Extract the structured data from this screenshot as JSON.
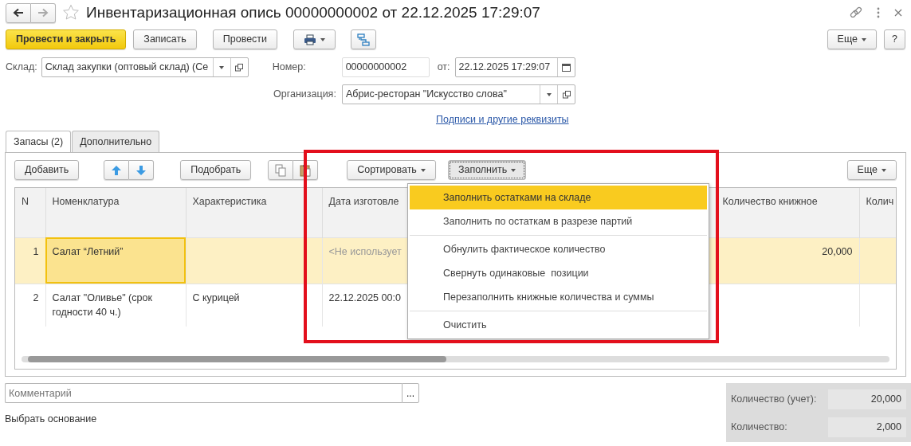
{
  "window": {
    "title": "Инвентаризационная опись 00000000002 от 22.12.2025 17:29:07",
    "favorite": false
  },
  "toolbar": [
    {
      "kind": "primary",
      "label": "Провести и закрыть"
    },
    {
      "kind": "plain",
      "label": "Записать"
    },
    {
      "kind": "plain",
      "label": "Провести"
    },
    {
      "kind": "print"
    },
    {
      "kind": "structure"
    }
  ],
  "toolbar_right": [
    {
      "kind": "dropdown",
      "label": "Еще"
    },
    {
      "kind": "plain",
      "label": "?"
    }
  ],
  "fields": {
    "warehouse": {
      "label": "Склад:",
      "value": "Склад закупки (оптовый склад) (Се"
    },
    "number": {
      "label": "Номер:",
      "value": "00000000002"
    },
    "date": {
      "label": "от:",
      "value": "22.12.2025 17:29:07"
    },
    "organization": {
      "label": "Организация:",
      "value": "Абрис-ресторан \"Искусство слова\""
    }
  },
  "signatures_link": "Подписи и другие реквизиты",
  "tabs": [
    {
      "label": "Запасы (2)",
      "selected": true
    },
    {
      "label": "Дополнительно",
      "selected": false
    }
  ],
  "table_toolbar": [
    {
      "kind": "plain",
      "label": "Добавить"
    },
    {
      "kind": "updown"
    },
    {
      "kind": "plain",
      "label": "Подобрать"
    },
    {
      "kind": "copypaste"
    },
    {
      "kind": "dropdown",
      "label": "Сортировать"
    },
    {
      "kind": "dropdown",
      "label": "Заполнить",
      "pressed": true
    }
  ],
  "table_toolbar_right": {
    "label": "Еще"
  },
  "table": {
    "columns": [
      "N",
      "Номенклатура",
      "Характеристика",
      "Дата изготовле",
      "Количество книжное",
      "Колич"
    ],
    "rows": [
      {
        "selected": true,
        "focused": true,
        "n": "1",
        "item": "Салат “Летний”",
        "date": {
          "text": "<Не использует",
          "placeholder": true
        },
        "qty_book": "20,000"
      },
      {
        "selected": false,
        "focused": false,
        "n": "2",
        "item": "Салат \"Оливье\" (срок годности 40 ч.)",
        "feature": "С курицей",
        "date": {
          "text": "22.12.2025 00:0",
          "placeholder": false
        }
      }
    ]
  },
  "fill_menu": {
    "groups": [
      [
        {
          "label": "Заполнить остатками на складе",
          "selected": true
        },
        {
          "label": "Заполнить по остаткам в разрезе партий",
          "selected": false
        }
      ],
      [
        {
          "label": "Обнулить фактическое количество",
          "selected": false
        },
        {
          "label": "Свернуть одинаковые  позиции",
          "selected": false
        },
        {
          "label": "Перезаполнить книжные количества и суммы",
          "selected": false
        }
      ],
      [
        {
          "label": "Очистить",
          "selected": false
        }
      ]
    ]
  },
  "comment": {
    "placeholder": "Комментарий",
    "button": "..."
  },
  "select_base": "Выбрать основание",
  "totals": [
    {
      "label": "Количество (учет):",
      "value": "20,000"
    },
    {
      "label": "Количество:",
      "value": "2,000"
    }
  ]
}
